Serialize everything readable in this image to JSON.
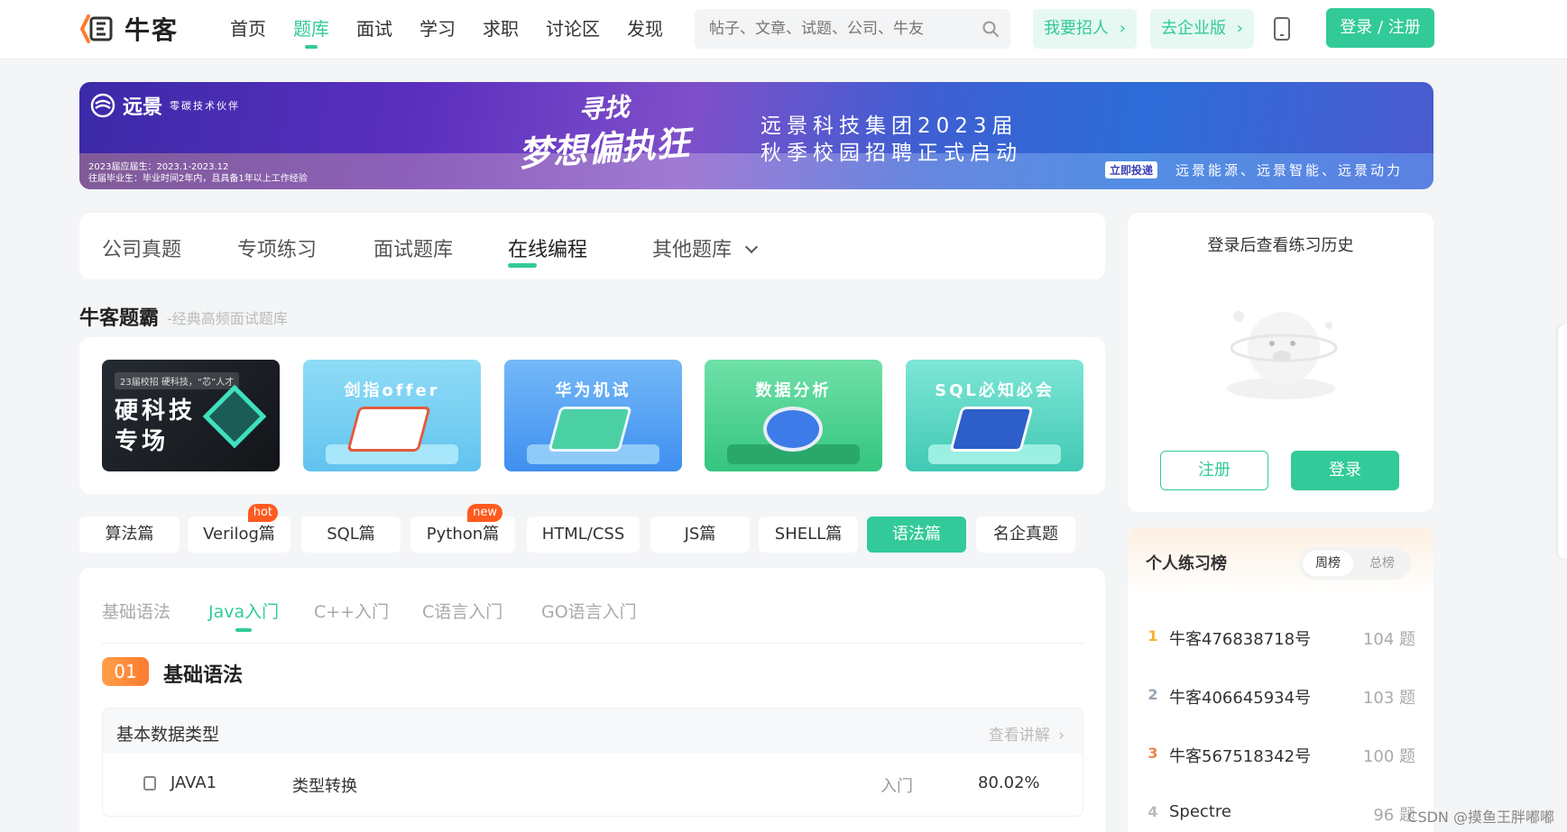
{
  "header": {
    "logo_text": "牛客",
    "nav": [
      "首页",
      "题库",
      "面试",
      "学习",
      "求职",
      "讨论区",
      "发现"
    ],
    "nav_active_index": 1,
    "search_placeholder": "帖子、文章、试题、公司、牛友",
    "recruit_label": "我要招人",
    "enterprise_label": "去企业版",
    "login_label": "登录 / 注册"
  },
  "banner": {
    "brand": "远景",
    "brand_sub": "零碳技术伙伴",
    "dates_line1": "2023届应届生：2023.1-2023.12",
    "dates_line2": "往届毕业生：毕业时间2年内，且具备1年以上工作经验",
    "slogan_top": "寻找",
    "slogan_main": "梦想偏执狂",
    "title_line1": "远景科技集团2023届",
    "title_line2": "秋季校园招聘正式启动",
    "apply": "立即投递",
    "subsidiaries": "远景能源、远景智能、远景动力"
  },
  "category_tabs": {
    "items": [
      "公司真题",
      "专项练习",
      "面试题库",
      "在线编程",
      "其他题库"
    ],
    "active_index": 3
  },
  "featured": {
    "title": "牛客题霸",
    "subtitle": "-经典高频面试题库",
    "cards": [
      {
        "badge": "23届校招 硬科技，“芯”人才",
        "title": "硬科技专场",
        "title_line1": "硬科技",
        "title_line2": "专场"
      },
      {
        "title": "剑指offer"
      },
      {
        "title": "华为机试"
      },
      {
        "title": "数据分析"
      },
      {
        "title": "SQL必知必会"
      }
    ]
  },
  "languages": {
    "items": [
      "算法篇",
      "Verilog篇",
      "SQL篇",
      "Python篇",
      "HTML/CSS",
      "JS篇",
      "SHELL篇",
      "语法篇",
      "名企真题"
    ],
    "badges": {
      "verilog": "hot",
      "python": "new"
    },
    "active_index": 7
  },
  "subtabs": {
    "items": [
      "基础语法",
      "Java入门",
      "C++入门",
      "C语言入门",
      "GO语言入门"
    ],
    "active_index": 1
  },
  "section": {
    "number": "01",
    "heading": "基础语法",
    "group_title": "基本数据类型",
    "view_link": "查看讲解",
    "rows": [
      {
        "id": "JAVA1",
        "name": "类型转换",
        "level": "入门",
        "pass_rate": "80.02%"
      }
    ]
  },
  "sidebar": {
    "history_title": "登录后查看练习历史",
    "register_label": "注册",
    "login_label": "登录"
  },
  "ranking": {
    "title": "个人练习榜",
    "tabs": [
      "周榜",
      "总榜"
    ],
    "active_tab": 0,
    "entries": [
      {
        "rank": "1",
        "name": "牛客476838718号",
        "count": "104 题"
      },
      {
        "rank": "2",
        "name": "牛客406645934号",
        "count": "103 题"
      },
      {
        "rank": "3",
        "name": "牛客567518342号",
        "count": "100 题"
      },
      {
        "rank": "4",
        "name": "Spectre",
        "count": "96 题"
      }
    ]
  },
  "watermark": "CSDN @摸鱼王胖嘟嘟",
  "colors": {
    "accent": "#32ca99",
    "badge": "#ff5a1f",
    "number_badge": "#ff8a38"
  }
}
